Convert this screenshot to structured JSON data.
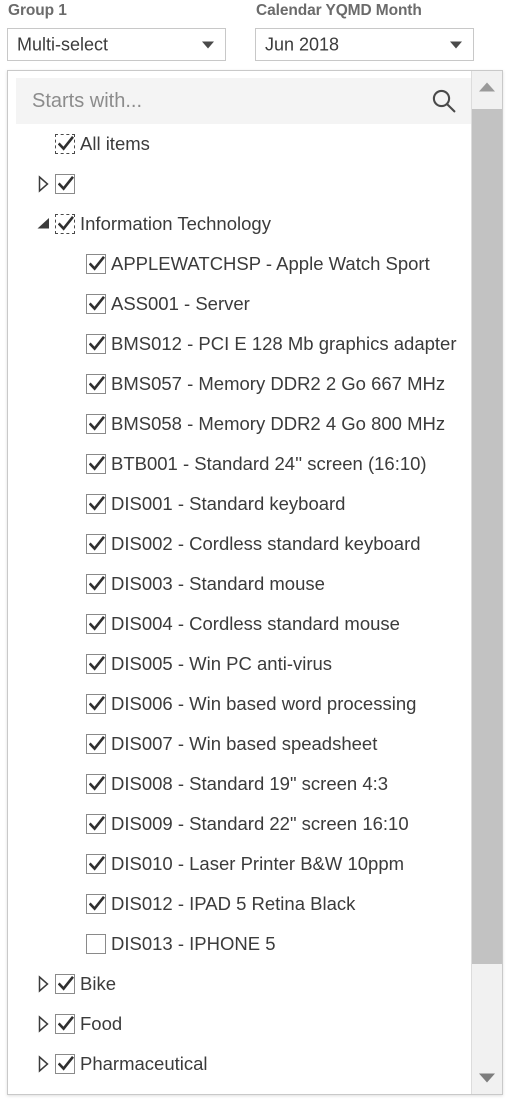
{
  "filters": [
    {
      "label": "Group 1",
      "value": "Multi-select",
      "icon": "chevron-down-icon"
    },
    {
      "label": "Calendar YQMD Month",
      "value": "Jun 2018",
      "icon": "chevron-down-icon"
    }
  ],
  "dropdown": {
    "search": {
      "placeholder": "Starts with...",
      "value": "",
      "icon": "search-icon"
    },
    "scrollbar": {
      "up_icon": "triangle-up-icon",
      "down_icon": "triangle-down-icon"
    },
    "tree": [
      {
        "label": "All items",
        "level": "root",
        "checked": true,
        "focused": true,
        "twisty": "none"
      },
      {
        "label": "",
        "level": "top",
        "checked": true,
        "focused": false,
        "twisty": "collapsed"
      },
      {
        "label": "Information Technology",
        "level": "top",
        "checked": true,
        "focused": true,
        "twisty": "expanded"
      },
      {
        "label": "APPLEWATCHSP - Apple Watch Sport",
        "level": "child",
        "checked": true,
        "focused": false,
        "twisty": "none"
      },
      {
        "label": "ASS001 - Server",
        "level": "child",
        "checked": true,
        "focused": false,
        "twisty": "none"
      },
      {
        "label": "BMS012 - PCI E 128 Mb graphics adapter",
        "level": "child",
        "checked": true,
        "focused": false,
        "twisty": "none"
      },
      {
        "label": "BMS057 - Memory DDR2 2 Go 667 MHz",
        "level": "child",
        "checked": true,
        "focused": false,
        "twisty": "none"
      },
      {
        "label": "BMS058 - Memory DDR2 4 Go 800 MHz",
        "level": "child",
        "checked": true,
        "focused": false,
        "twisty": "none"
      },
      {
        "label": "BTB001 - Standard 24'' screen (16:10)",
        "level": "child",
        "checked": true,
        "focused": false,
        "twisty": "none"
      },
      {
        "label": "DIS001 - Standard keyboard",
        "level": "child",
        "checked": true,
        "focused": false,
        "twisty": "none"
      },
      {
        "label": "DIS002 - Cordless standard keyboard",
        "level": "child",
        "checked": true,
        "focused": false,
        "twisty": "none"
      },
      {
        "label": "DIS003 - Standard mouse",
        "level": "child",
        "checked": true,
        "focused": false,
        "twisty": "none"
      },
      {
        "label": "DIS004 - Cordless standard mouse",
        "level": "child",
        "checked": true,
        "focused": false,
        "twisty": "none"
      },
      {
        "label": "DIS005 - Win PC anti-virus",
        "level": "child",
        "checked": true,
        "focused": false,
        "twisty": "none"
      },
      {
        "label": "DIS006 - Win based word processing",
        "level": "child",
        "checked": true,
        "focused": false,
        "twisty": "none"
      },
      {
        "label": "DIS007 - Win based speadsheet",
        "level": "child",
        "checked": true,
        "focused": false,
        "twisty": "none"
      },
      {
        "label": "DIS008 - Standard 19\" screen 4:3",
        "level": "child",
        "checked": true,
        "focused": false,
        "twisty": "none"
      },
      {
        "label": "DIS009 - Standard 22\" screen 16:10",
        "level": "child",
        "checked": true,
        "focused": false,
        "twisty": "none"
      },
      {
        "label": "DIS010 - Laser Printer B&W 10ppm",
        "level": "child",
        "checked": true,
        "focused": false,
        "twisty": "none"
      },
      {
        "label": "DIS012 - IPAD 5 Retina Black",
        "level": "child",
        "checked": true,
        "focused": false,
        "twisty": "none"
      },
      {
        "label": "DIS013 - IPHONE 5",
        "level": "child",
        "checked": false,
        "focused": false,
        "twisty": "none"
      },
      {
        "label": "Bike",
        "level": "top",
        "checked": true,
        "focused": false,
        "twisty": "collapsed"
      },
      {
        "label": "Food",
        "level": "top",
        "checked": true,
        "focused": false,
        "twisty": "collapsed"
      },
      {
        "label": "Pharmaceutical",
        "level": "top",
        "checked": true,
        "focused": false,
        "twisty": "collapsed"
      }
    ]
  },
  "colors": {
    "text": "#3b3b3b",
    "label": "#6b6b6b",
    "border": "#c8c8c8",
    "search_bg": "#f4f4f4",
    "scroll_track": "#f1f1f1",
    "scroll_thumb": "#c2c2c2"
  }
}
